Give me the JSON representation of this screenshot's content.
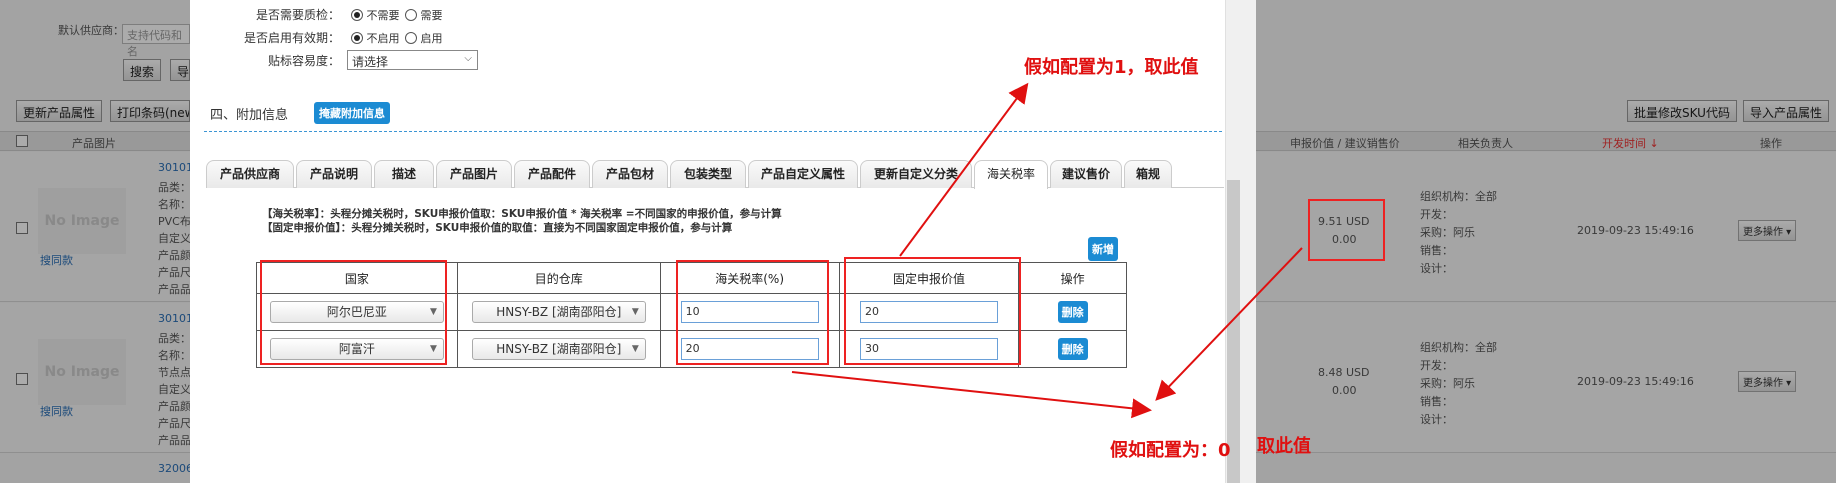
{
  "background": {
    "supplier_label": "默认供应商：",
    "supplier_placeholder": "支持代码和名",
    "search_btn": "搜索",
    "search_btn2": "导",
    "btn_update_attr": "更新产品属性",
    "btn_print": "打印条码(new",
    "btn_bulk_sku": "批量修改SKU代码",
    "btn_import": "导入产品属性",
    "header_image": "产品图片",
    "header_price": "申报价值 / 建议销售价",
    "header_owner": "相关负责人",
    "header_dev_time": "开发时间 ↓",
    "header_ops": "操作",
    "rows": [
      {
        "code": "30101",
        "no_image": "No Image",
        "link": "搜同款",
        "lines": [
          "品类：",
          "名称：",
          "PVC布",
          "自定义",
          "产品颜",
          "产品尺",
          "产品品"
        ],
        "price": "9.51 USD",
        "price2": "0.00",
        "owners": [
          "组织机构：全部",
          "开发：",
          "采购：阿乐",
          "销售：",
          "设计："
        ],
        "time": "2019-09-23 15:49:16",
        "more": "更多操作 ▾"
      },
      {
        "code": "30101",
        "no_image": "No Image",
        "link": "搜同款",
        "lines": [
          "品类：",
          "名称：",
          "节点点",
          "自定义",
          "产品颜",
          "产品尺",
          "产品品"
        ],
        "price": "8.48 USD",
        "price2": "0.00",
        "owners": [
          "组织机构：全部",
          "开发：",
          "采购：阿乐",
          "销售：",
          "设计："
        ],
        "time": "2019-09-23 15:49:16",
        "more": "更多操作 ▾"
      }
    ],
    "row3_code": "32006"
  },
  "modal": {
    "qc_label": "是否需要质检：",
    "qc_options": [
      "不需要",
      "需要"
    ],
    "expiry_label": "是否启用有效期：",
    "expiry_options": [
      "不启用",
      "启用"
    ],
    "label_ease_label": "贴标容易度：",
    "label_ease_value": "请选择",
    "section_title": "四、附加信息",
    "hide_extra_btn": "掩藏附加信息",
    "tabs": [
      "产品供应商",
      "产品说明",
      "描述",
      "产品图片",
      "产品配件",
      "产品包材",
      "包装类型",
      "产品自定义属性",
      "更新自定义分类",
      "海关税率",
      "建议售价",
      "箱规"
    ],
    "active_tab": "海关税率",
    "note1": "【海关税率】：头程分摊关税时，SKU申报价值取：SKU申报价值 * 海关税率 =不同国家的申报价值，参与计算",
    "note2": "【固定申报价值】：头程分摊关税时，SKU申报价值的取值：直接为不同国家固定申报价值，参与计算",
    "add_btn": "新增",
    "table": {
      "headers": [
        "国家",
        "目的仓库",
        "海关税率(%)",
        "固定申报价值",
        "操作"
      ],
      "rows": [
        {
          "country": "阿尔巴尼亚",
          "warehouse": "HNSY-BZ [湖南邵阳仓]",
          "rate": "10",
          "fixed": "20",
          "op": "删除"
        },
        {
          "country": "阿富汗",
          "warehouse": "HNSY-BZ [湖南邵阳仓]",
          "rate": "20",
          "fixed": "30",
          "op": "删除"
        }
      ]
    }
  },
  "annotations": {
    "top": "假如配置为1，取此值",
    "bottom1": "假如配置为：0",
    "bottom2": "取此值",
    "color": "#e01010"
  }
}
